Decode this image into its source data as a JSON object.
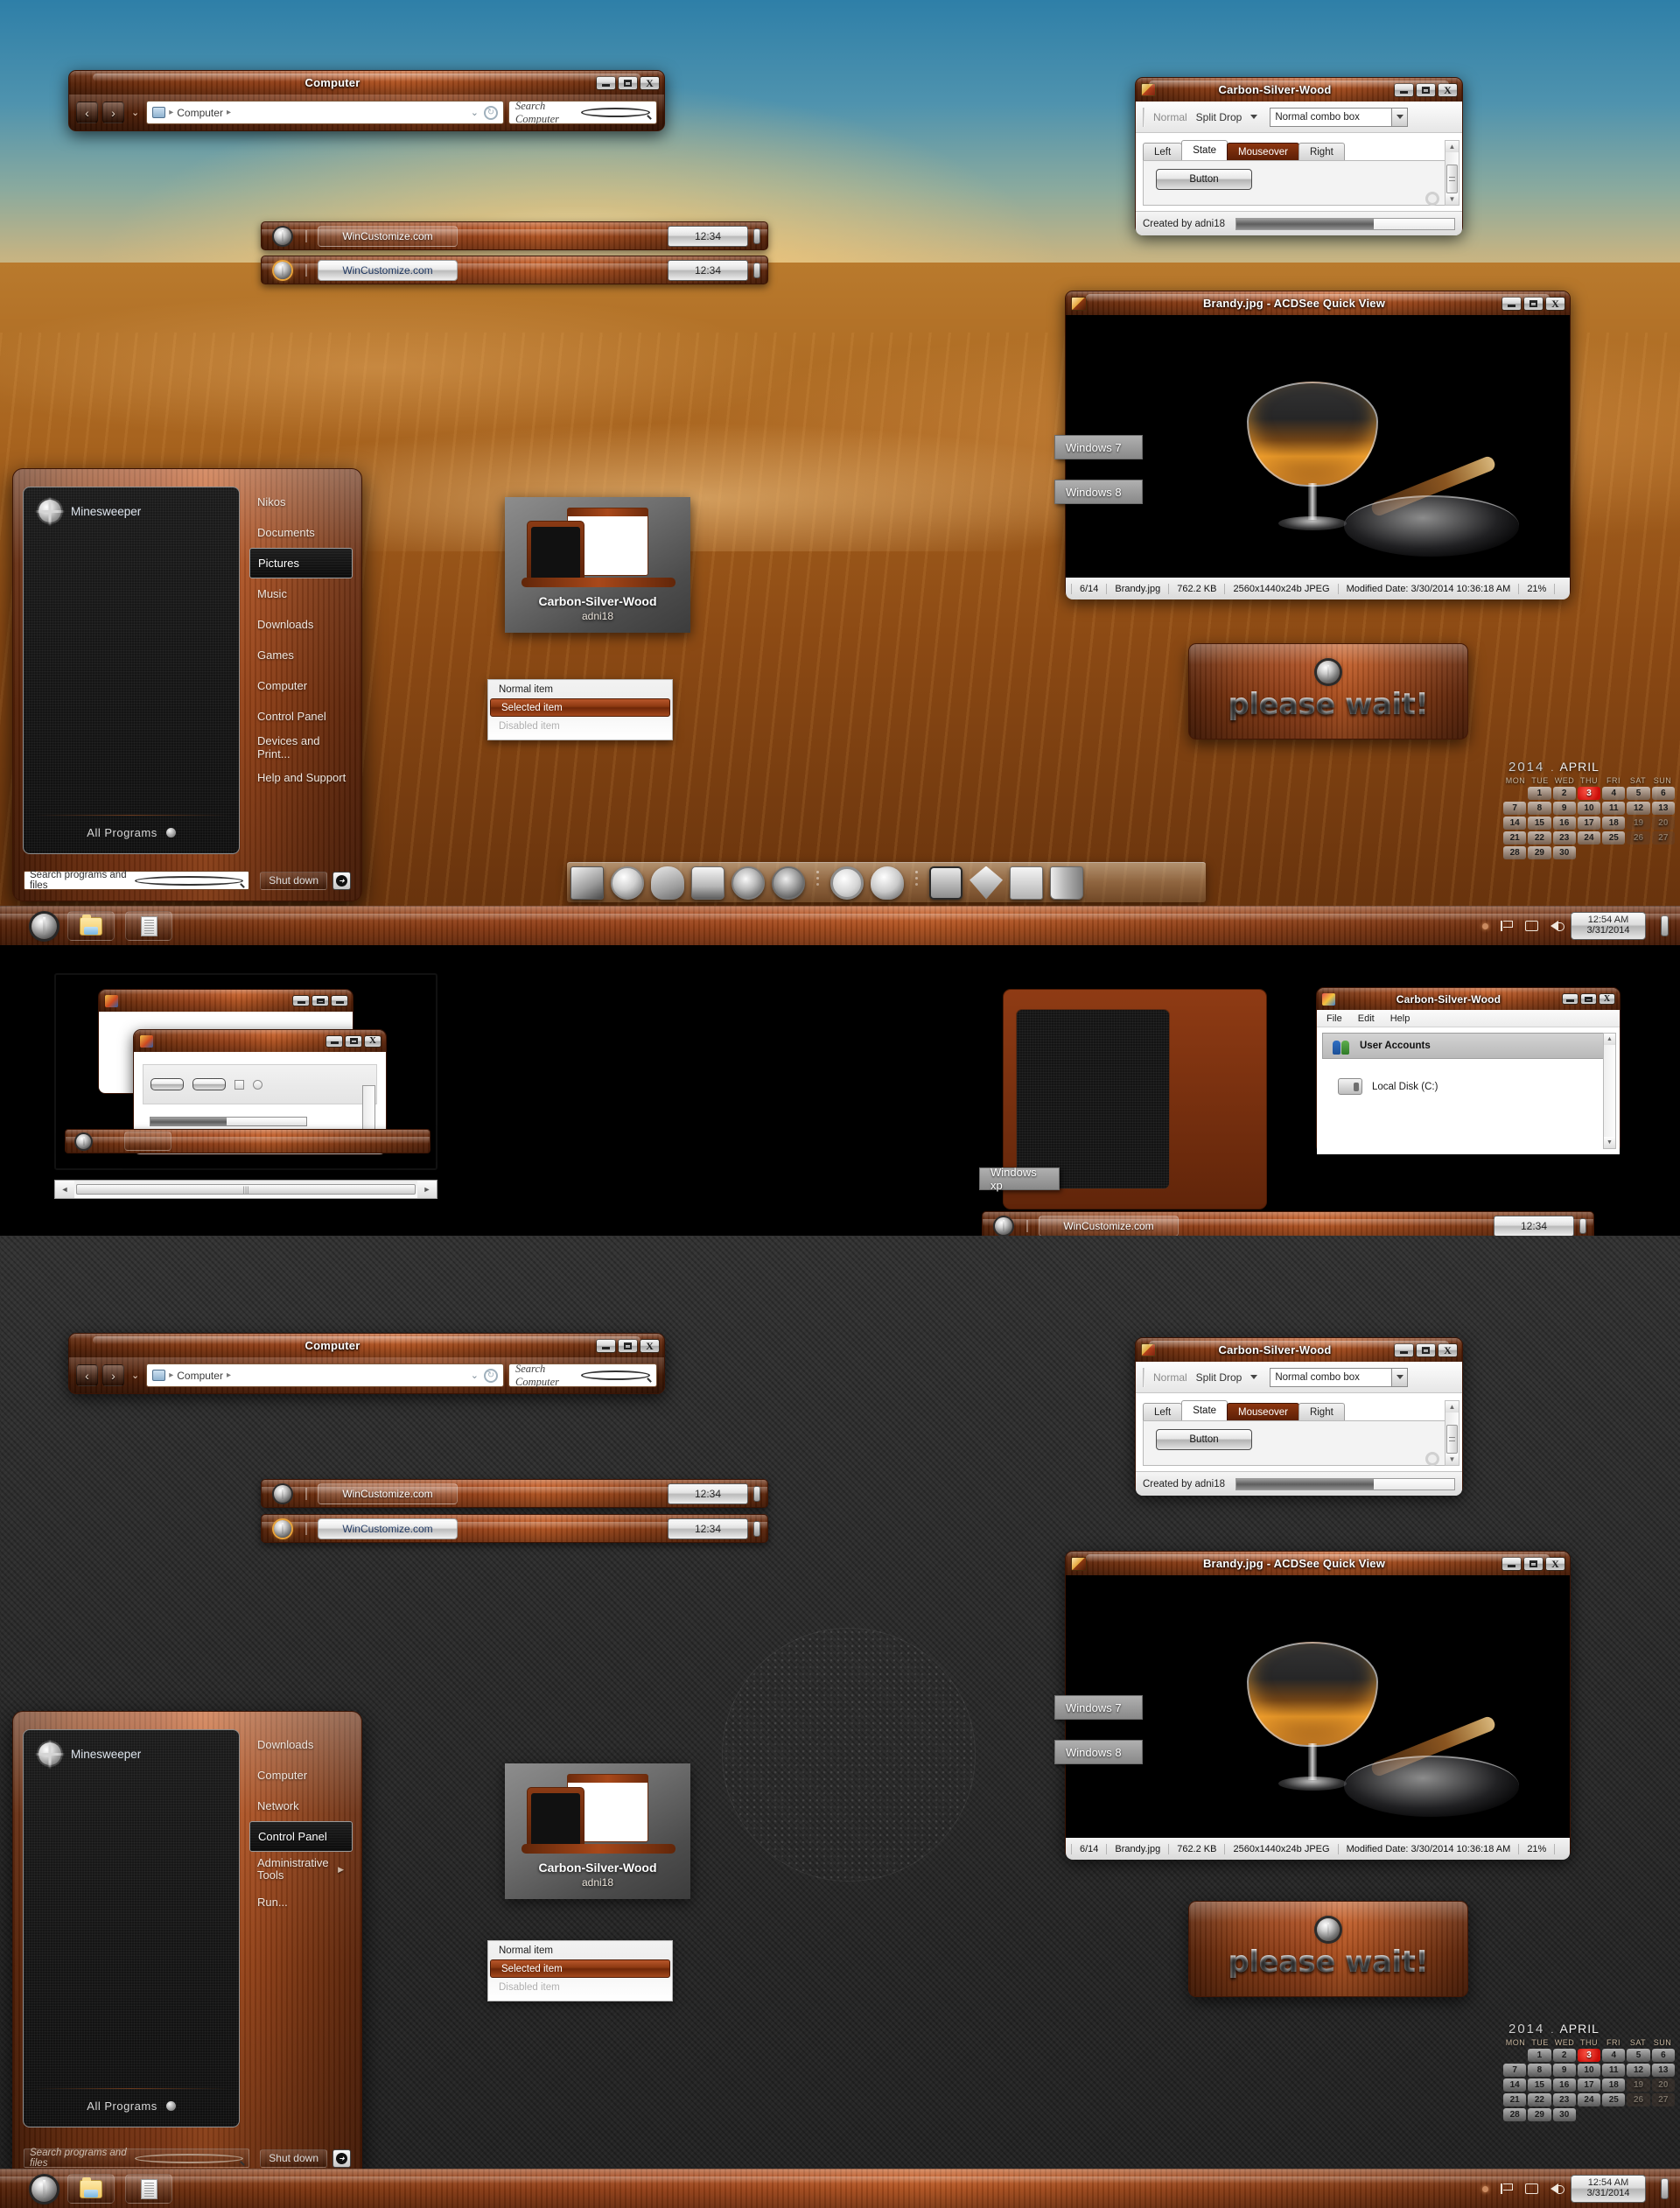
{
  "theme": {
    "name": "Carbon-Silver-Wood",
    "author": "adni18",
    "accent": "#a8481a",
    "accent_dark": "#5d2408"
  },
  "explorer": {
    "title": "Computer",
    "back_icon": "‹",
    "forward_icon": "›",
    "dropdown_icon": "⌄",
    "breadcrumb_root": "Computer",
    "breadcrumb_sep": "▸",
    "refresh_icon": "↻",
    "search_placeholder": "Search Computer",
    "search_icon": "search-icon",
    "buttons": {
      "minimize": "—",
      "maximize": "❐",
      "close": "X"
    }
  },
  "csw_dialog": {
    "title": "Carbon-Silver-Wood",
    "toolbar": {
      "normal": "Normal",
      "split_drop": "Split Drop",
      "combo_value": "Normal combo box"
    },
    "tabs": [
      {
        "label": "Left",
        "state": "normal"
      },
      {
        "label": "State",
        "state": "active"
      },
      {
        "label": "Mouseover",
        "state": "hot"
      },
      {
        "label": "Right",
        "state": "normal"
      }
    ],
    "button_label": "Button",
    "status_text": "Created by adni18",
    "progress_percent": 63,
    "scroll_up": "▲",
    "scroll_down": "▼"
  },
  "acdsee": {
    "title": "Brandy.jpg - ACDSee Quick View",
    "status": [
      "6/14",
      "Brandy.jpg",
      "762.2 KB",
      "2560x1440x24b JPEG",
      "Modified Date: 3/30/2014 10:36:18 AM",
      "21%"
    ]
  },
  "tooltips": {
    "win7": "Windows 7",
    "win8": "Windows 8",
    "winxp": "Windows xp"
  },
  "start_menu_top": {
    "pinned_app": "Minesweeper",
    "pinned_icon": "mine-icon",
    "all_programs": "All Programs",
    "items": [
      {
        "label": "Nikos",
        "selected": false,
        "submenu": false
      },
      {
        "label": "Documents",
        "selected": false,
        "submenu": false
      },
      {
        "label": "Pictures",
        "selected": true,
        "submenu": false
      },
      {
        "label": "Music",
        "selected": false,
        "submenu": false
      },
      {
        "label": "Downloads",
        "selected": false,
        "submenu": false
      },
      {
        "label": "Games",
        "selected": false,
        "submenu": false
      },
      {
        "label": "Computer",
        "selected": false,
        "submenu": false
      },
      {
        "label": "Control Panel",
        "selected": false,
        "submenu": false
      },
      {
        "label": "Devices and Print...",
        "selected": false,
        "submenu": false
      },
      {
        "label": "Help and Support",
        "selected": false,
        "submenu": false
      }
    ],
    "search_placeholder": "Search programs and files",
    "shutdown_label": "Shut down",
    "shutdown_arrow": "➜"
  },
  "start_menu_bottom": {
    "pinned_app": "Minesweeper",
    "all_programs": "All Programs",
    "items": [
      {
        "label": "Downloads",
        "selected": false,
        "submenu": false
      },
      {
        "label": "Computer",
        "selected": false,
        "submenu": false
      },
      {
        "label": "Network",
        "selected": false,
        "submenu": false
      },
      {
        "label": "Control Panel",
        "selected": true,
        "submenu": false
      },
      {
        "label": "Administrative Tools",
        "selected": false,
        "submenu": true
      },
      {
        "label": "Run...",
        "selected": false,
        "submenu": false
      }
    ],
    "search_placeholder": "Search programs and files",
    "shutdown_label": "Shut down",
    "shutdown_arrow": "➜"
  },
  "theme_thumb": {
    "name": "Carbon-Silver-Wood",
    "author": "adni18"
  },
  "menu_popup": {
    "items": [
      {
        "label": "Normal item",
        "state": "normal"
      },
      {
        "label": "Selected item",
        "state": "selected"
      },
      {
        "label": "Disabled item",
        "state": "disabled"
      }
    ]
  },
  "please_wait": {
    "label": "please wait!"
  },
  "calendar": {
    "year": "2014",
    "separator": ".",
    "month": "APRIL",
    "dow": [
      "MON",
      "TUE",
      "WED",
      "THU",
      "FRI",
      "SAT",
      "SUN"
    ],
    "leading_blanks": 1,
    "days": [
      1,
      2,
      3,
      4,
      5,
      6,
      7,
      8,
      9,
      10,
      11,
      12,
      13,
      14,
      15,
      16,
      17,
      18,
      19,
      20,
      21,
      22,
      23,
      24,
      25,
      26,
      27,
      28,
      29,
      30
    ],
    "today": 3,
    "dim_days": [
      19,
      20,
      26,
      27
    ]
  },
  "taskbar": {
    "start_icon": "start-orb-icon",
    "buttons": [
      {
        "name": "explorer",
        "icon": "folder-icon"
      },
      {
        "name": "notepad",
        "icon": "document-icon"
      }
    ],
    "tray_icons": [
      "dot-icon",
      "flag-icon",
      "network-icon",
      "speaker-icon"
    ],
    "clock_time": "12:54 AM",
    "clock_date": "3/31/2014"
  },
  "wc_taskbars": [
    {
      "label": "WinCustomize.com",
      "clock": "12:34",
      "style": "dark-tab",
      "orb_glow": false
    },
    {
      "label": "WinCustomize.com",
      "clock": "12:34",
      "style": "light-tab",
      "orb_glow": true
    },
    {
      "label": "WinCustomize.com",
      "clock": "12:34",
      "style": "dark-tab",
      "orb_glow": false
    }
  ],
  "dock": {
    "icons": [
      "monitor-icon",
      "stopwatch-icon",
      "user-icon",
      "clock-drive-icon",
      "speaker-icon",
      "film-reel-icon",
      "magnifier-icon",
      "phone-headset-icon",
      "iphone-icon",
      "gem-icon",
      "calculator-icon",
      "trash-icon"
    ]
  },
  "user_accounts_window": {
    "title": "Carbon-Silver-Wood",
    "menu": [
      "File",
      "Edit",
      "Help"
    ],
    "selected_item": "User Accounts",
    "items": [
      "Local Disk (C:)"
    ],
    "scroll_up": "▲",
    "scroll_down": "▼"
  },
  "xp_demo": {
    "scroll_left": "◄",
    "scroll_right": "►",
    "scroll_grip": "|||"
  }
}
